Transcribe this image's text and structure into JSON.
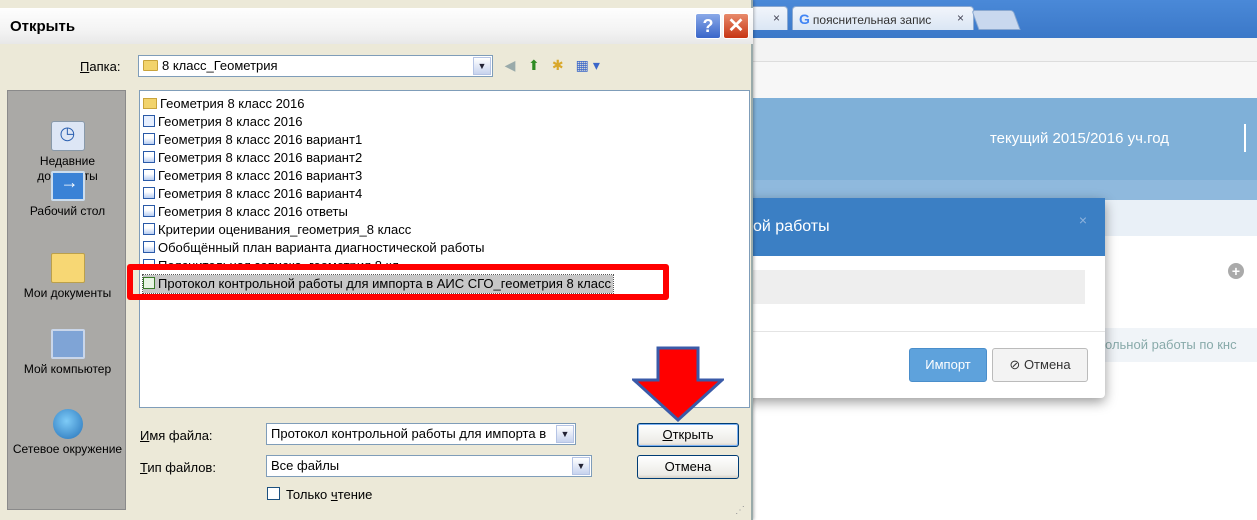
{
  "browser": {
    "tab1_close": "×",
    "tab2_title": "пояснительная запис",
    "tab2_close": "×",
    "google_glyph": "G",
    "academic_year": "текущий 2015/2016 уч.год",
    "row_text": "ольной работы по кнс"
  },
  "modal": {
    "title": "ой работы",
    "close": "×",
    "import_label": "Импорт",
    "cancel_label": "Отмена",
    "cancel_icon": "⊘"
  },
  "dialog": {
    "title": "Открыть",
    "help": "?",
    "close": "✕",
    "folder_label": "Папка:",
    "folder_value": "8 класс_Геометрия",
    "places": [
      {
        "label": "Недавние документы",
        "icon": "recent-documents-icon"
      },
      {
        "label": "Рабочий стол",
        "icon": "desktop-icon"
      },
      {
        "label": "Мои документы",
        "icon": "my-documents-icon"
      },
      {
        "label": "Мой компьютер",
        "icon": "my-computer-icon"
      },
      {
        "label": "Сетевое окружение",
        "icon": "network-icon"
      }
    ],
    "files": [
      {
        "name": "Геометрия 8 класс 2016",
        "icon": "folder"
      },
      {
        "name": "Геометрия 8 класс 2016",
        "icon": "shortcut"
      },
      {
        "name": "Геометрия 8 класс 2016 вариант1",
        "icon": "word"
      },
      {
        "name": "Геометрия 8 класс 2016 вариант2",
        "icon": "word"
      },
      {
        "name": "Геометрия 8 класс 2016 вариант3",
        "icon": "word"
      },
      {
        "name": "Геометрия 8 класс 2016 вариант4",
        "icon": "word"
      },
      {
        "name": "Геометрия 8 класс 2016 ответы",
        "icon": "word"
      },
      {
        "name": "Критерии оценивания_геометрия_8 класс",
        "icon": "word"
      },
      {
        "name": "Обобщённый план варианта диагностической работы",
        "icon": "word"
      },
      {
        "name": "Пояснительная записка_геометрия 8 кл",
        "icon": "word"
      },
      {
        "name": "Протокол контрольной работы для импорта в АИС СГО_геометрия 8 класс",
        "icon": "excel",
        "selected": true
      }
    ],
    "filename_label": "Имя файла:",
    "filename_value": "Протокол контрольной работы для импорта в",
    "filetype_label": "Тип файлов:",
    "filetype_value": "Все файлы",
    "readonly_label": "Только чтение",
    "open_label": "Открыть",
    "cancel_label": "Отмена",
    "combo_arrow": "▼"
  },
  "annotations": {
    "highlight_color": "#ff0000",
    "arrow_color": "#ff0000",
    "arrow_outline": "#3a5aa8"
  }
}
